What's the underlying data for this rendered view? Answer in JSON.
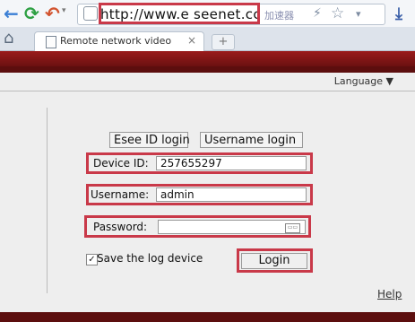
{
  "browser": {
    "url": "http://www.e seenet.cc",
    "accelerator_label": "加速器",
    "tab_title": "Remote network video",
    "tab_close": "×",
    "new_tab": "+"
  },
  "page": {
    "language_label": "Language ▼",
    "esee_login_label": "Esee ID login",
    "username_login_label": "Username login",
    "device_id_label": "Device ID:",
    "device_id_value": "257655297",
    "username_label": "Username:",
    "username_value": "admin",
    "password_label": "Password:",
    "password_value": "",
    "save_device_label": "Save the log device",
    "save_device_checked": true,
    "login_label": "Login",
    "help_label": "Help"
  },
  "colors": {
    "highlight": "#c93949",
    "banner": "#8a1616"
  }
}
